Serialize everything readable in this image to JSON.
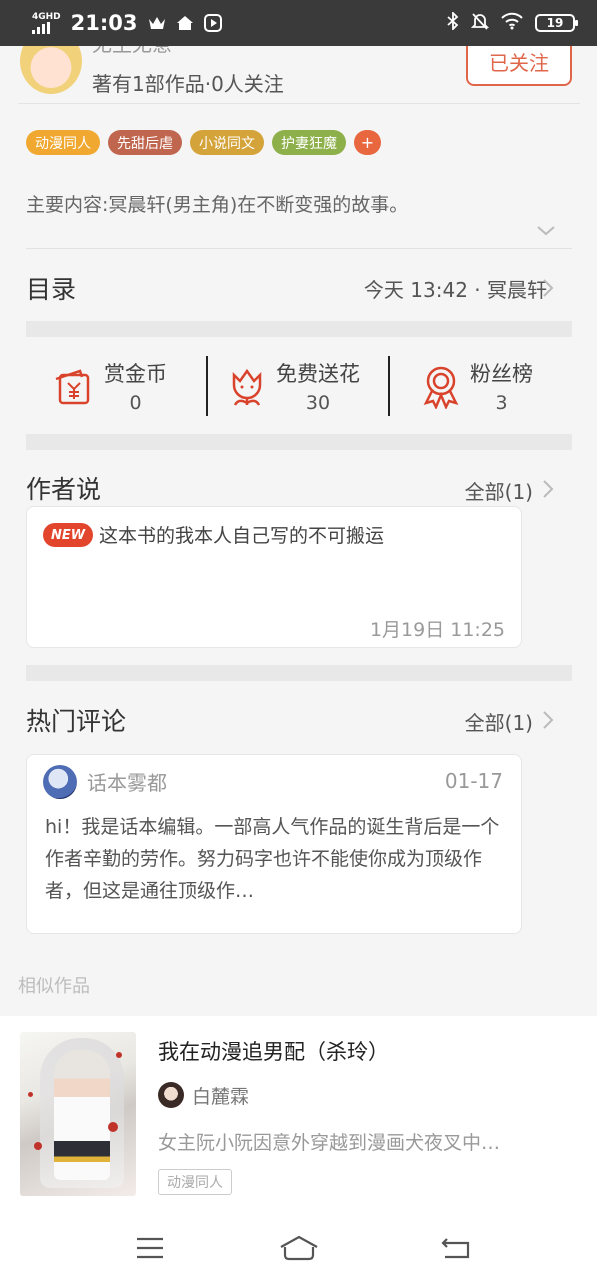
{
  "status_bar": {
    "network": "4GHD",
    "time": "21:03",
    "battery": "19",
    "icons": [
      "signal-icon",
      "crown-icon",
      "home-icon",
      "play-icon",
      "bluetooth-icon",
      "mute-icon",
      "wifi-icon",
      "battery-icon"
    ]
  },
  "author": {
    "name": "无生无意",
    "meta": "著有1部作品·0人关注",
    "follow_label": "已关注"
  },
  "tags": [
    {
      "label": "动漫同人",
      "color": "#f0a830"
    },
    {
      "label": "先甜后虐",
      "color": "#c0654e"
    },
    {
      "label": "小说同文",
      "color": "#d4a33a"
    },
    {
      "label": "护妻狂魔",
      "color": "#8eb04a"
    }
  ],
  "tag_add": "+",
  "summary": "主要内容:冥晨轩(男主角)在不断变强的故事。",
  "catalog": {
    "title": "目录",
    "latest": "今天 13:42 · 冥晨轩"
  },
  "stats": [
    {
      "label": "赏金币",
      "value": "0",
      "icon": "reward-icon"
    },
    {
      "label": "免费送花",
      "value": "30",
      "icon": "flower-icon"
    },
    {
      "label": "粉丝榜",
      "value": "3",
      "icon": "medal-icon"
    }
  ],
  "author_notes": {
    "title": "作者说",
    "all_label": "全部(1)",
    "badge": "NEW",
    "text": "这本书的我本人自己写的不可搬运",
    "time": "1月19日  11:25"
  },
  "hot_comments": {
    "title": "热门评论",
    "all_label": "全部(1)",
    "user": "话本雾都",
    "date": "01-17",
    "text": "hi！我是话本编辑。一部高人气作品的诞生背后是一个作者辛勤的劳作。努力码字也许不能使你成为顶级作者，但这是通往顶级作…"
  },
  "similar": {
    "label": "相似作品",
    "title": "我在动漫追男配（杀玲）",
    "author": "白麓霖",
    "desc": "女主阮小阮因意外穿越到漫画犬夜叉中…",
    "tag": "动漫同人"
  },
  "colors": {
    "accent": "#e0664a",
    "icon_red": "#d9432c"
  }
}
